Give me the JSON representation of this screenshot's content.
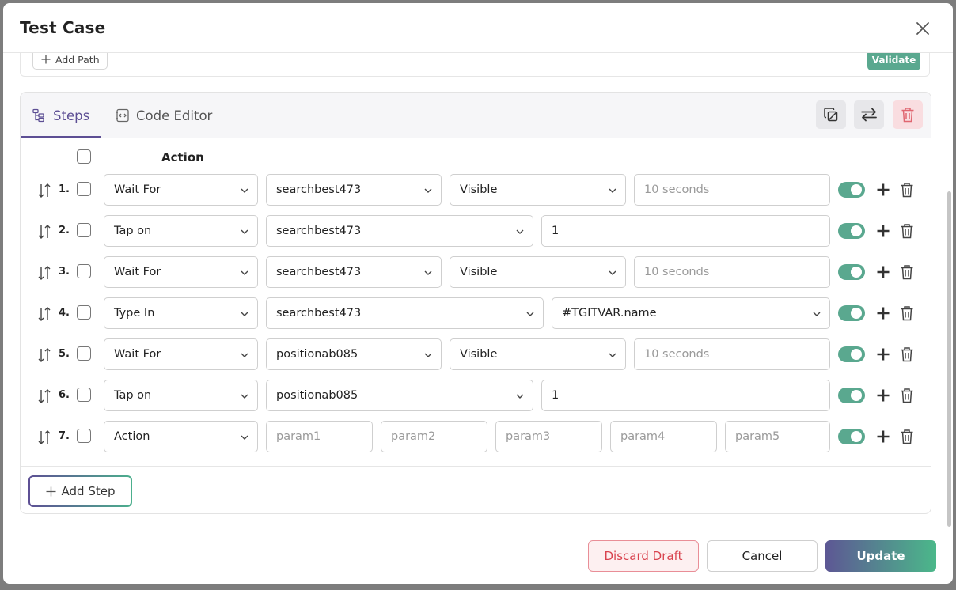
{
  "modal": {
    "title": "Test Case"
  },
  "path": {
    "add_label": "Add Path",
    "validate_label": "Validate"
  },
  "tabs": [
    {
      "label": "Steps",
      "active": true
    },
    {
      "label": "Code Editor",
      "active": false
    }
  ],
  "table": {
    "action_header": "Action"
  },
  "rows": [
    {
      "num": "1.",
      "action": "Wait For",
      "target": "searchbest473",
      "cond": "Visible",
      "value": "10 seconds"
    },
    {
      "num": "2.",
      "action": "Tap on",
      "target": "searchbest473",
      "value": "1"
    },
    {
      "num": "3.",
      "action": "Wait For",
      "target": "searchbest473",
      "cond": "Visible",
      "value": "10 seconds"
    },
    {
      "num": "4.",
      "action": "Type In",
      "target": "searchbest473",
      "value": "#TGITVAR.name"
    },
    {
      "num": "5.",
      "action": "Wait For",
      "target": "positionab085",
      "cond": "Visible",
      "value": "10 seconds"
    },
    {
      "num": "6.",
      "action": "Tap on",
      "target": "positionab085",
      "value": "1"
    },
    {
      "num": "7.",
      "action": "Action",
      "params": [
        "param1",
        "param2",
        "param3",
        "param4",
        "param5"
      ]
    }
  ],
  "add_step_label": "Add Step",
  "footer": {
    "discard_label": "Discard Draft",
    "cancel_label": "Cancel",
    "update_label": "Update"
  },
  "colors": {
    "accent": "#5d4f94",
    "green": "#5aa88f",
    "danger": "#d9434f"
  }
}
